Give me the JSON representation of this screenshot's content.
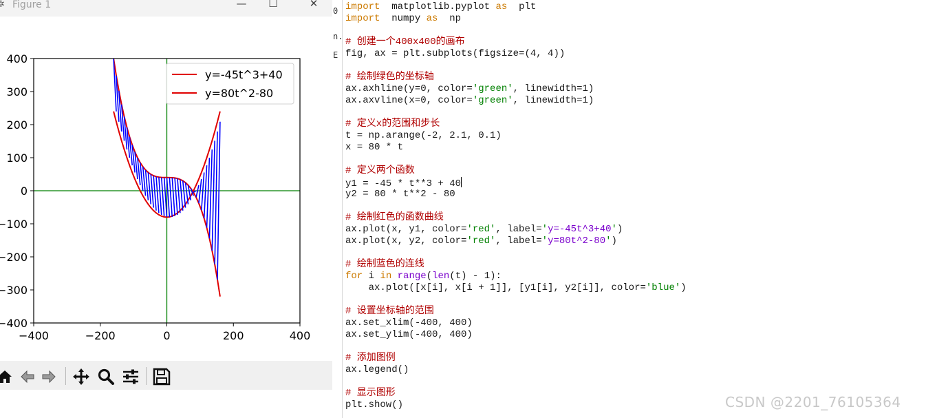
{
  "figure_window": {
    "title": "Figure 1",
    "minimize_glyph": "—",
    "maximize_glyph": "☐",
    "close_glyph": "✕"
  },
  "chart_data": {
    "type": "line",
    "xlim": [
      -400,
      400
    ],
    "ylim": [
      -400,
      400
    ],
    "xticks": [
      -400,
      -200,
      0,
      200,
      400
    ],
    "yticks": [
      -400,
      -300,
      -200,
      -100,
      0,
      100,
      200,
      300,
      400
    ],
    "xtick_labels": [
      "−400",
      "−200",
      "0",
      "200",
      "400"
    ],
    "ytick_labels": [
      "−400",
      "−300",
      "−200",
      "−100",
      "0",
      "100",
      "200",
      "300",
      "400"
    ],
    "axhline": {
      "y": 0,
      "color": "#008000"
    },
    "axvline": {
      "x": 0,
      "color": "#008000"
    },
    "t": [
      -2.0,
      -1.9,
      -1.8,
      -1.7,
      -1.6,
      -1.5,
      -1.4,
      -1.3,
      -1.2,
      -1.1,
      -1.0,
      -0.9,
      -0.8,
      -0.7,
      -0.6,
      -0.5,
      -0.4,
      -0.3,
      -0.2,
      -0.1,
      0.0,
      0.1,
      0.2,
      0.3,
      0.4,
      0.5,
      0.6,
      0.7,
      0.8,
      0.9,
      1.0,
      1.1,
      1.2,
      1.3,
      1.4,
      1.5,
      1.6,
      1.7,
      1.8,
      1.9,
      2.0
    ],
    "series": [
      {
        "name": "y=-45t^3+40",
        "color": "#e00000",
        "y": "-45*t^3+40"
      },
      {
        "name": "y=80t^2-80",
        "color": "#e00000",
        "y": "80*t^2-80"
      }
    ],
    "x": "80*t",
    "connector_color": "#0000ff",
    "legend_position": "upper right"
  },
  "toolbar": {
    "icons": [
      "home-icon",
      "back-icon",
      "forward-icon",
      "pan-icon",
      "zoom-icon",
      "configure-subplots-icon",
      "save-icon"
    ]
  },
  "editor": {
    "gutter_fragments": [
      "0",
      "n.",
      "E"
    ],
    "lines": [
      [
        [
          "kw",
          "import"
        ],
        [
          "",
          "  matplotlib.pyplot "
        ],
        [
          "kw",
          "as"
        ],
        [
          "",
          "  plt"
        ]
      ],
      [
        [
          "kw",
          "import"
        ],
        [
          "",
          "  numpy "
        ],
        [
          "kw",
          "as"
        ],
        [
          "",
          "  np"
        ]
      ],
      [],
      [
        [
          "cm",
          "# 创建一个400x400的画布"
        ]
      ],
      [
        [
          "",
          "fig, ax = plt.subplots(figsize=(4, 4))"
        ]
      ],
      [],
      [
        [
          "cm",
          "# 绘制绿色的坐标轴"
        ]
      ],
      [
        [
          "",
          "ax.axhline(y=0, color="
        ],
        [
          "st",
          "'green'"
        ],
        [
          "",
          ", linewidth=1)"
        ]
      ],
      [
        [
          "",
          "ax.axvline(x=0, color="
        ],
        [
          "st",
          "'green'"
        ],
        [
          "",
          ", linewidth=1)"
        ]
      ],
      [],
      [
        [
          "cm",
          "# 定义x的范围和步长"
        ]
      ],
      [
        [
          "",
          "t = np.arange(-2, 2.1, 0.1)"
        ]
      ],
      [
        [
          "",
          "x = 80 * t"
        ]
      ],
      [],
      [
        [
          "cm",
          "# 定义两个函数"
        ]
      ],
      [
        [
          "",
          "y1 = -45 * t**3 + 40"
        ]
      ],
      [
        [
          "",
          "y2 = 80 * t**2 - 80"
        ]
      ],
      [],
      [
        [
          "cm",
          "# 绘制红色的函数曲线"
        ]
      ],
      [
        [
          "",
          "ax.plot(x, y1, color="
        ],
        [
          "st",
          "'red'"
        ],
        [
          "",
          ", label="
        ],
        [
          "st",
          "'"
        ],
        [
          "fn",
          "y=-45t^3+40"
        ],
        [
          "st",
          "'"
        ],
        [
          "",
          ")"
        ]
      ],
      [
        [
          "",
          "ax.plot(x, y2, color="
        ],
        [
          "st",
          "'red'"
        ],
        [
          "",
          ", label="
        ],
        [
          "st",
          "'"
        ],
        [
          "fn",
          "y=80t^2-80"
        ],
        [
          "st",
          "'"
        ],
        [
          "",
          ")"
        ]
      ],
      [],
      [
        [
          "cm",
          "# 绘制蓝色的连线"
        ]
      ],
      [
        [
          "kw",
          "for"
        ],
        [
          "",
          " i "
        ],
        [
          "kw",
          "in"
        ],
        [
          "",
          " "
        ],
        [
          "fn",
          "range"
        ],
        [
          "",
          "("
        ],
        [
          "fn",
          "len"
        ],
        [
          "",
          "(t) - 1):"
        ]
      ],
      [
        [
          "",
          "    ax.plot([x[i], x[i + 1]], [y1[i], y2[i]], color="
        ],
        [
          "st",
          "'blue'"
        ],
        [
          "",
          ")"
        ]
      ],
      [],
      [
        [
          "cm",
          "# 设置坐标轴的范围"
        ]
      ],
      [
        [
          "",
          "ax.set_xlim(-400, 400)"
        ]
      ],
      [
        [
          "",
          "ax.set_ylim(-400, 400)"
        ]
      ],
      [],
      [
        [
          "cm",
          "# 添加图例"
        ]
      ],
      [
        [
          "",
          "ax.legend()"
        ]
      ],
      [],
      [
        [
          "cm",
          "# 显示图形"
        ]
      ],
      [
        [
          "",
          "plt.show()"
        ]
      ]
    ]
  },
  "watermark": "CSDN @2201_76105364"
}
